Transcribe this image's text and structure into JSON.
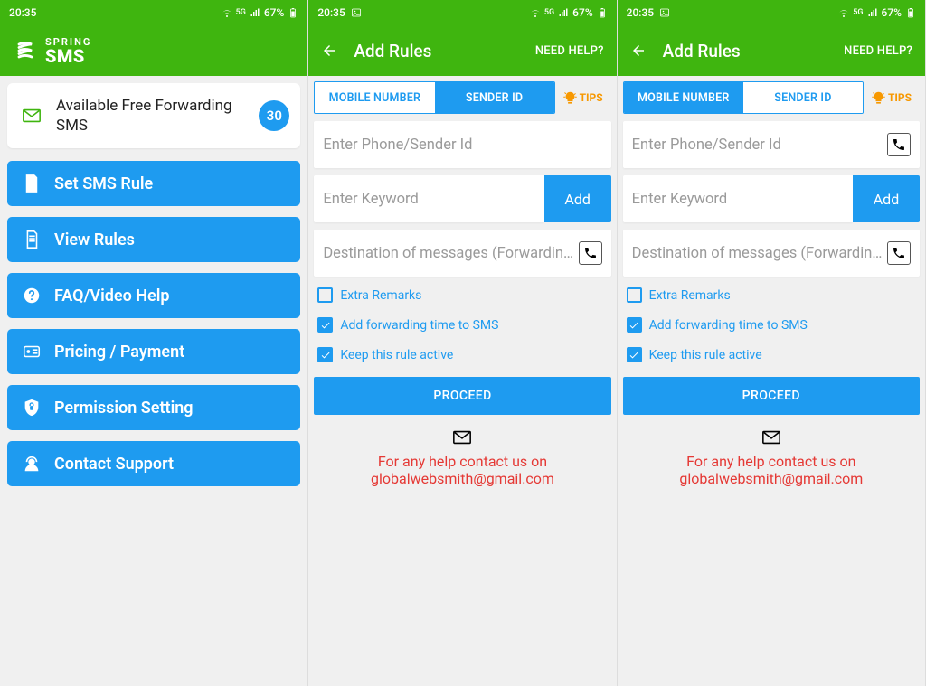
{
  "status": {
    "time": "20:35",
    "battery": "67%",
    "has_img_icon_s2": true
  },
  "brand": {
    "top": "SPRING",
    "bottom": "SMS"
  },
  "s1": {
    "card_text": "Available Free Forwarding SMS",
    "card_badge": "30",
    "menu": [
      {
        "label": "Set SMS Rule",
        "icon": "set-rule"
      },
      {
        "label": "View Rules",
        "icon": "view-rules"
      },
      {
        "label": "FAQ/Video Help",
        "icon": "faq"
      },
      {
        "label": "Pricing / Payment",
        "icon": "pricing"
      },
      {
        "label": "Permission Setting",
        "icon": "permission"
      },
      {
        "label": "Contact Support",
        "icon": "support"
      }
    ]
  },
  "s2": {
    "title": "Add Rules",
    "need_help": "NEED HELP?",
    "tabs": {
      "mobile": "MOBILE NUMBER",
      "sender": "SENDER ID",
      "tips": "TIPS"
    },
    "ph_sender": "Enter Phone/Sender Id",
    "ph_keyword": "Enter Keyword",
    "add": "Add",
    "ph_dest": "Destination of messages (Forwardin…",
    "chk_remarks": "Extra Remarks",
    "chk_time": "Add forwarding time to SMS",
    "chk_active": "Keep this rule active",
    "proceed": "PROCEED",
    "help1": "For any help contact us on",
    "help2": "globalwebsmith@gmail.com"
  }
}
